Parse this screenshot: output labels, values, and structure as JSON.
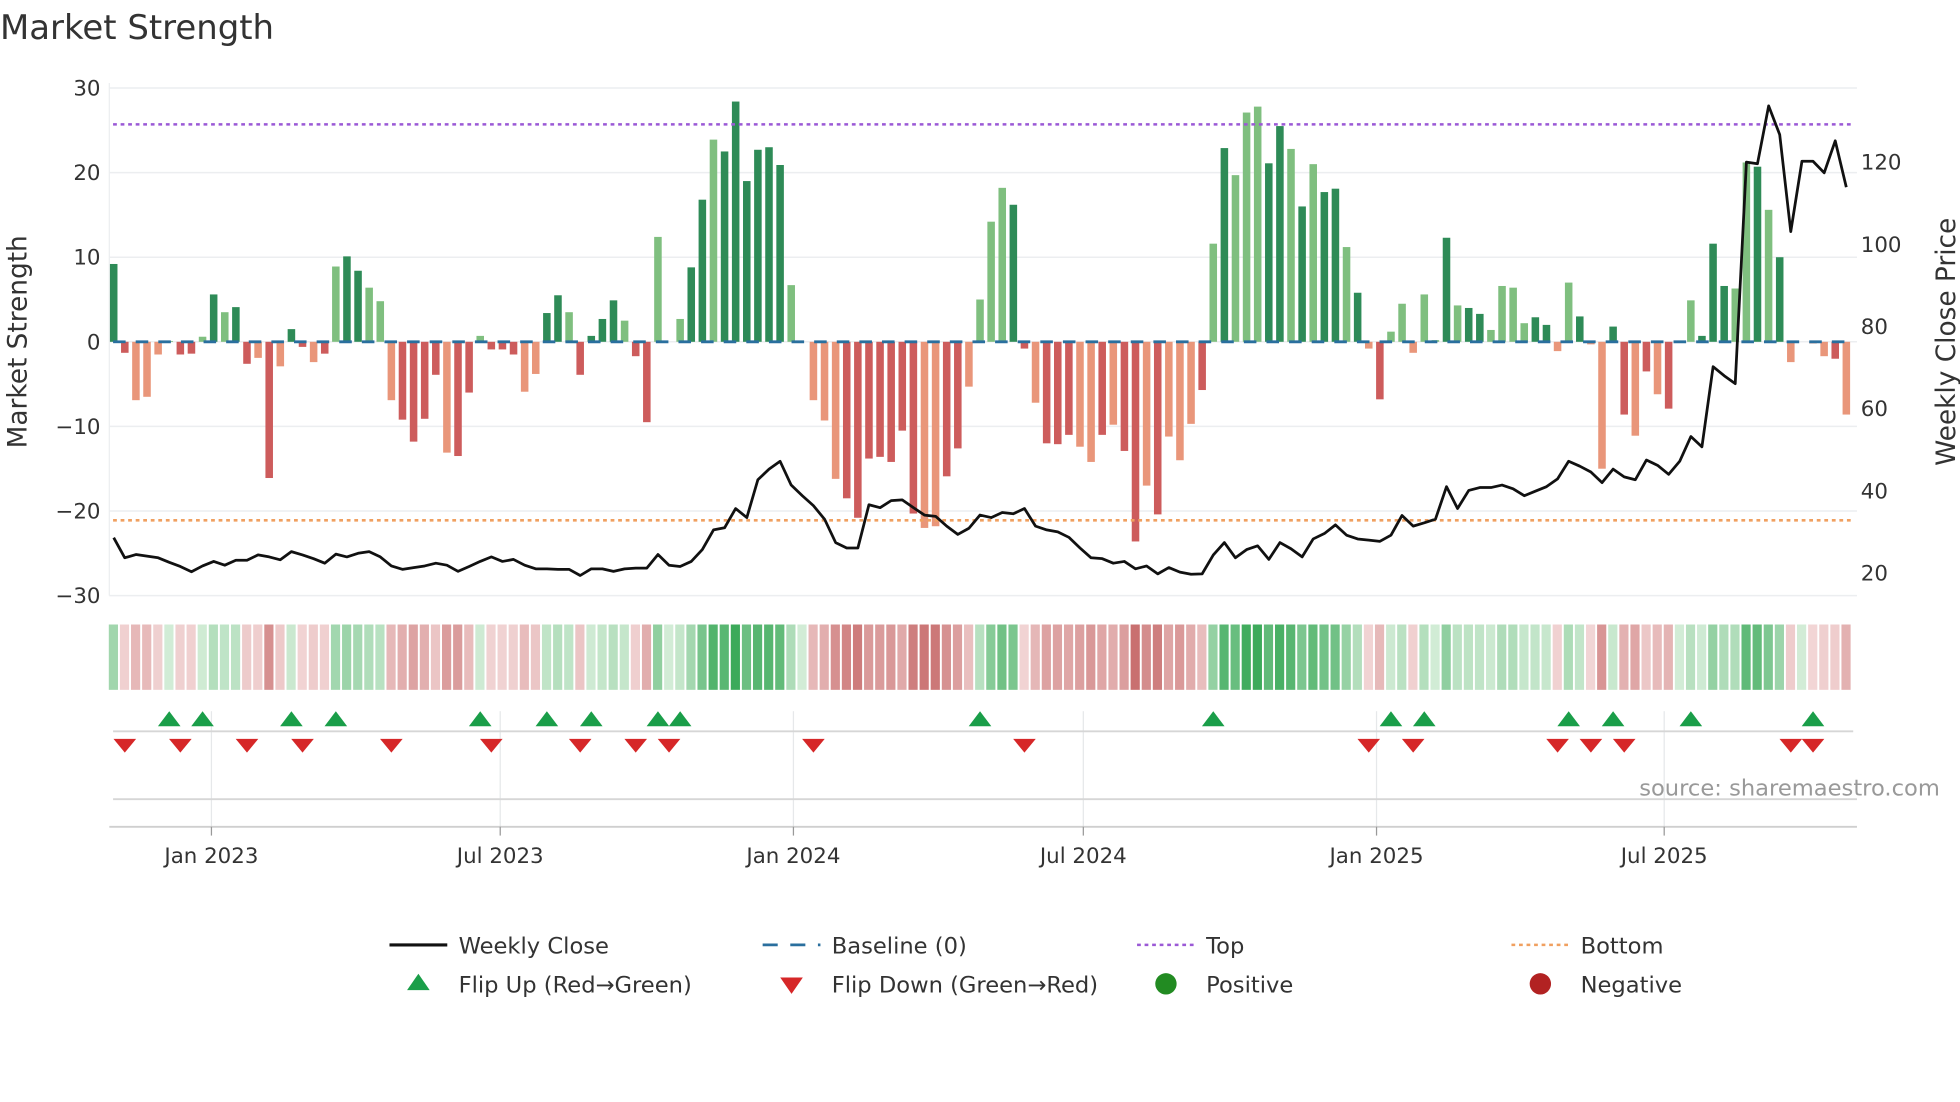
{
  "title": "Market Strength",
  "source": "source: sharemaestro.com",
  "colors": {
    "bar_strong_pos": "#2e8b57",
    "bar_weak_pos": "#7fbf7f",
    "bar_strong_neg": "#cd5c5c",
    "bar_weak_neg": "#e9967a",
    "line": "#111111",
    "baseline": "#2a6f9e",
    "top": "#9b59d6",
    "bottom": "#f0a060",
    "flip_up": "#1a9e49",
    "flip_down": "#d62728",
    "positive": "#228b22",
    "negative": "#b22222"
  },
  "chart_data": {
    "type": "bar+line",
    "title": "Market Strength",
    "ylabel": "Market Strength",
    "y2label": "Weekly Close Price",
    "ylim": [
      -30,
      30
    ],
    "y2lim": [
      20,
      130
    ],
    "yticks": [
      "30",
      "20",
      "10",
      "0",
      "−10",
      "−20",
      "−30"
    ],
    "y2ticks": [
      "120",
      "100",
      "80",
      "60",
      "40",
      "20"
    ],
    "x_ticks": [
      {
        "label": "Jan 2023",
        "week": 8.8
      },
      {
        "label": "Jul 2023",
        "week": 34.8
      },
      {
        "label": "Jan 2024",
        "week": 61.2
      },
      {
        "label": "Jul 2024",
        "week": 87.3
      },
      {
        "label": "Jan 2025",
        "week": 113.7
      },
      {
        "label": "Jul 2025",
        "week": 139.6
      }
    ],
    "top_level": 25.7,
    "bottom_level": -21.1,
    "strength": [
      9.2,
      -1.3,
      -6.9,
      -6.5,
      -1.5,
      0.1,
      -1.5,
      -1.4,
      0.6,
      5.6,
      3.5,
      4.1,
      -2.6,
      -1.9,
      -16.1,
      -2.9,
      1.5,
      -0.6,
      -2.4,
      -1.4,
      8.9,
      10.1,
      8.4,
      6.4,
      4.8,
      -6.9,
      -9.2,
      -11.8,
      -9.1,
      -3.9,
      -13.1,
      -13.5,
      -6.0,
      0.7,
      -0.9,
      -0.9,
      -1.5,
      -5.9,
      -3.8,
      3.4,
      5.5,
      3.5,
      -3.9,
      0.7,
      2.7,
      4.9,
      2.5,
      -1.7,
      -9.5,
      12.4,
      0,
      2.7,
      8.8,
      16.8,
      23.9,
      22.5,
      28.4,
      19.0,
      22.7,
      23.0,
      20.9,
      6.7,
      0,
      -6.9,
      -9.3,
      -16.2,
      -18.5,
      -20.8,
      -13.8,
      -13.6,
      -14.2,
      -10.5,
      -20.3,
      -22.0,
      -21.8,
      -15.9,
      -12.6,
      -5.3,
      5.0,
      14.2,
      18.2,
      16.2,
      -0.8,
      -7.2,
      -12.0,
      -12.1,
      -11.0,
      -12.4,
      -14.2,
      -11.0,
      -9.8,
      -12.9,
      -23.6,
      -17.0,
      -20.4,
      -11.2,
      -14.0,
      -9.7,
      -5.7,
      11.6,
      22.9,
      19.7,
      27.1,
      27.8,
      21.1,
      25.5,
      22.8,
      16.0,
      21.0,
      17.7,
      18.1,
      11.2,
      5.8,
      -0.8,
      -6.8,
      1.2,
      4.5,
      -1.3,
      5.6,
      0.2,
      12.3,
      4.3,
      4.0,
      3.3,
      1.4,
      6.6,
      6.4,
      2.2,
      2.9,
      2.0,
      -1.1,
      7.0,
      3.0,
      -0.3,
      -15.0,
      1.8,
      -8.6,
      -11.1,
      -3.5,
      -6.2,
      -7.9,
      0,
      4.9,
      0.7,
      11.6,
      6.6,
      6.3,
      21.2,
      20.7,
      15.6,
      10.0,
      -2.4,
      0,
      -0.2,
      -1.7,
      -2.0,
      -8.6
    ],
    "shade": "sswwwwsswswsswswsswswsswwwsssswsswssswwsswsssswsswwwsswsssssswswwwssssssswwsswwwwsswssswwswsswswwwswswwwsswswsswswswwwwwswsswwwwsswwswwsswswsswssswwswswwwwswss",
    "close": [
      28.6,
      23.7,
      24.5,
      24.1,
      23.7,
      22.6,
      21.6,
      20.3,
      21.7,
      22.8,
      21.9,
      23.1,
      23.1,
      24.4,
      23.9,
      23.2,
      25.2,
      24.4,
      23.5,
      22.4,
      24.6,
      23.9,
      24.8,
      25.2,
      23.9,
      21.7,
      20.9,
      21.3,
      21.7,
      22.4,
      21.9,
      20.4,
      21.6,
      22.8,
      23.9,
      22.8,
      23.3,
      21.9,
      21.0,
      21.0,
      20.9,
      20.9,
      19.4,
      21.0,
      21.0,
      20.4,
      21.0,
      21.2,
      21.2,
      24.5,
      21.9,
      21.6,
      22.8,
      25.7,
      30.5,
      31.0,
      35.7,
      33.5,
      42.7,
      45.3,
      47.2,
      41.4,
      38.8,
      36.4,
      33.1,
      27.4,
      26.1,
      26.1,
      36.6,
      35.9,
      37.6,
      37.8,
      35.9,
      34.1,
      33.8,
      31.4,
      29.4,
      30.9,
      34.1,
      33.5,
      34.7,
      34.4,
      35.7,
      31.4,
      30.5,
      30.0,
      28.7,
      26.1,
      23.7,
      23.5,
      22.4,
      22.8,
      21.0,
      21.7,
      19.8,
      21.3,
      20.2,
      19.7,
      19.8,
      24.4,
      27.4,
      23.7,
      25.7,
      26.6,
      23.3,
      27.4,
      25.9,
      23.9,
      28.3,
      29.6,
      31.7,
      29.2,
      28.3,
      28.0,
      27.7,
      29.2,
      34.0,
      31.4,
      32.2,
      33.1,
      41.0,
      35.7,
      40.1,
      40.8,
      40.8,
      41.4,
      40.5,
      38.8,
      39.9,
      41.0,
      42.9,
      47.2,
      46.0,
      44.6,
      42.0,
      45.3,
      43.4,
      42.7,
      47.5,
      46.2,
      44.0,
      47.2,
      53.2,
      50.7,
      70.2,
      68.0,
      66.1,
      120.0,
      119.6,
      133.7,
      126.7,
      103.1,
      120.2,
      120.2,
      117.4,
      125.2,
      113.9
    ],
    "flip_up_weeks": [
      5,
      8,
      16,
      20,
      33,
      39,
      43,
      49,
      51,
      78,
      99,
      115,
      118,
      131,
      135,
      142,
      153
    ],
    "flip_down_weeks": [
      1,
      6,
      12,
      17,
      25,
      34,
      42,
      47,
      50,
      63,
      82,
      113,
      117,
      130,
      133,
      136,
      151,
      153
    ],
    "legend": [
      {
        "label": "Weekly Close",
        "symbol": "line"
      },
      {
        "label": "Baseline (0)",
        "symbol": "dash"
      },
      {
        "label": "Top",
        "symbol": "dot-purple"
      },
      {
        "label": "Bottom",
        "symbol": "dot-orange"
      },
      {
        "label": "Flip Up (Red→Green)",
        "symbol": "tri-up"
      },
      {
        "label": "Flip Down (Green→Red)",
        "symbol": "tri-down"
      },
      {
        "label": "Positive",
        "symbol": "circle-green"
      },
      {
        "label": "Negative",
        "symbol": "circle-red"
      }
    ],
    "legend_position": "bottom"
  }
}
